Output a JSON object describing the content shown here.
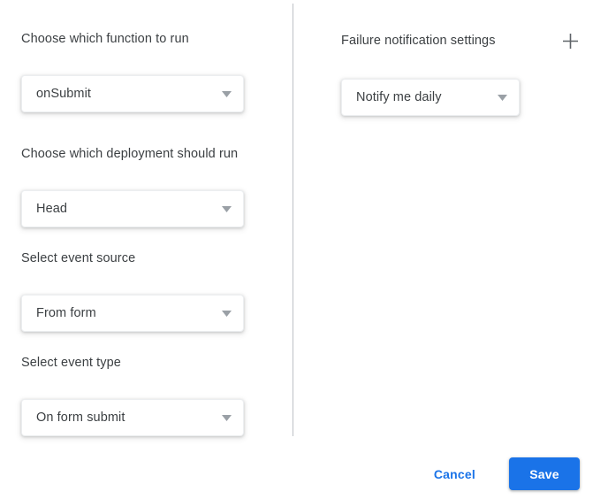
{
  "dialog": {
    "left_column": {
      "fields": [
        {
          "label": "Choose which function to run",
          "value": "onSubmit",
          "arrow_icon": "chevron-down-icon"
        },
        {
          "label": "Choose which deployment should run",
          "value": "Head",
          "arrow_icon": "chevron-down-icon"
        },
        {
          "label": "Select event source",
          "value": "From form",
          "arrow_icon": "chevron-down-icon"
        },
        {
          "label": "Select event type",
          "value": "On form submit",
          "arrow_icon": "chevron-down-icon"
        }
      ]
    },
    "right_column": {
      "notification": {
        "label": "Failure notification settings",
        "add_icon": "plus-icon",
        "value": "Notify me daily",
        "arrow_icon": "chevron-down-icon"
      }
    },
    "footer": {
      "cancel_label": "Cancel",
      "save_label": "Save"
    }
  },
  "colors": {
    "accent": "#1a73e8",
    "text": "#3c4043",
    "divider": "#bdc1c6",
    "arrow": "#9aa0a6",
    "surface": "#ffffff"
  }
}
